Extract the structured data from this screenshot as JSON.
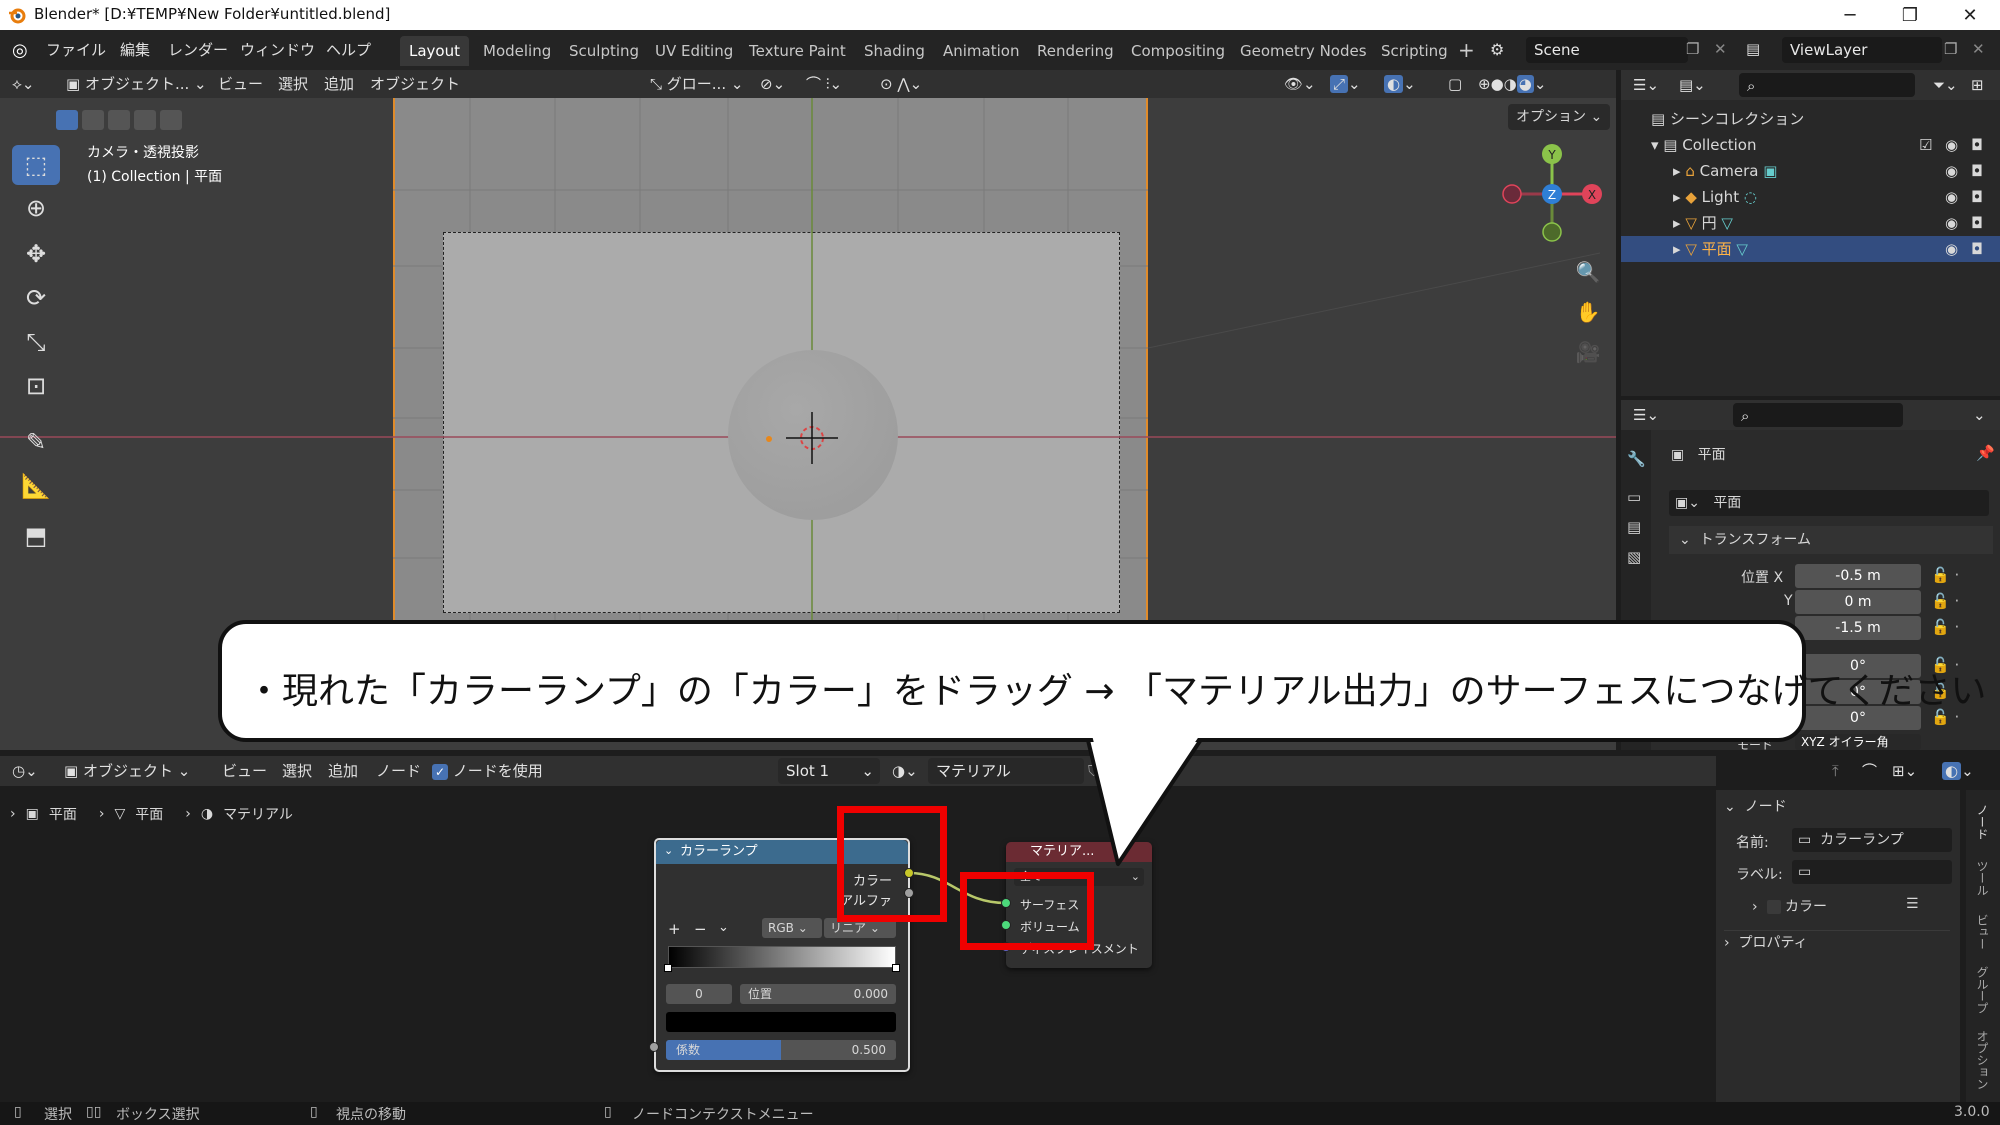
{
  "window": {
    "title": "Blender* [D:¥TEMP¥New Folder¥untitled.blend]"
  },
  "menu": [
    "ファイル",
    "編集",
    "レンダー",
    "ウィンドウ",
    "ヘルプ"
  ],
  "workspaces": [
    "Layout",
    "Modeling",
    "Sculpting",
    "UV Editing",
    "Texture Paint",
    "Shading",
    "Animation",
    "Rendering",
    "Compositing",
    "Geometry Nodes",
    "Scripting"
  ],
  "scene": "Scene",
  "view_layer": "ViewLayer",
  "viewport_header": {
    "mode": "オブジェクト...",
    "menus": [
      "ビュー",
      "選択",
      "追加",
      "オブジェクト"
    ],
    "transform": "グロー...",
    "options": "オプション"
  },
  "viewport_overlay": {
    "line1": "カメラ・透視投影",
    "line2": "(1) Collection | 平面"
  },
  "outliner": {
    "scene_collection": "シーンコレクション",
    "items": [
      {
        "name": "Collection"
      },
      {
        "name": "Camera"
      },
      {
        "name": "Light"
      },
      {
        "name": "円"
      },
      {
        "name": "平面"
      }
    ]
  },
  "properties": {
    "object_name": "平面",
    "data_name": "平面",
    "panel": "トランスフォーム",
    "location": {
      "x_label": "位置 X",
      "y_label": "Y",
      "x": "-0.5 m",
      "y": "0 m",
      "z": "-1.5 m"
    },
    "rotation": [
      "0°",
      "0°",
      "0°"
    ],
    "mode_label": "モード",
    "mode_value": "XYZ オイラー角"
  },
  "callout": {
    "text": "・現れた「カラーランプ」の「カラー」をドラッグ → 「マテリアル出力」のサーフェスにつなげてください"
  },
  "node_header": {
    "mode": "オブジェクト",
    "menus": [
      "ビュー",
      "選択",
      "追加",
      "ノード"
    ],
    "use_nodes": "ノードを使用",
    "slot": "Slot 1",
    "material": "マテリアル"
  },
  "breadcrumb": [
    "平面",
    "平面",
    "マテリアル"
  ],
  "color_ramp_node": {
    "title": "カラーランプ",
    "out_color": "カラー",
    "out_alpha": "アルファ",
    "mode": "RGB",
    "interp": "リニア",
    "index": "0",
    "pos_label": "位置",
    "pos_value": "0.000",
    "fac_label": "係数",
    "fac_value": "0.500",
    "fac": 0.5
  },
  "output_node": {
    "title": "マテリア...",
    "target": "全て",
    "surface": "サーフェス",
    "volume": "ボリューム",
    "displacement": "ディスプレイスメント"
  },
  "npanel": {
    "section": "ノード",
    "name_label": "名前:",
    "name_value": "カラーランプ",
    "label_label": "ラベル:",
    "color": "カラー",
    "props": "プロパティ",
    "tabs": [
      "ノード",
      "ツール",
      "ビュー",
      "グループ",
      "オプション"
    ]
  },
  "status": {
    "select": "選択",
    "box_select": "ボックス選択",
    "move_view": "視点の移動",
    "context": "ノードコンテクストメニュー",
    "version": "3.0.0"
  }
}
